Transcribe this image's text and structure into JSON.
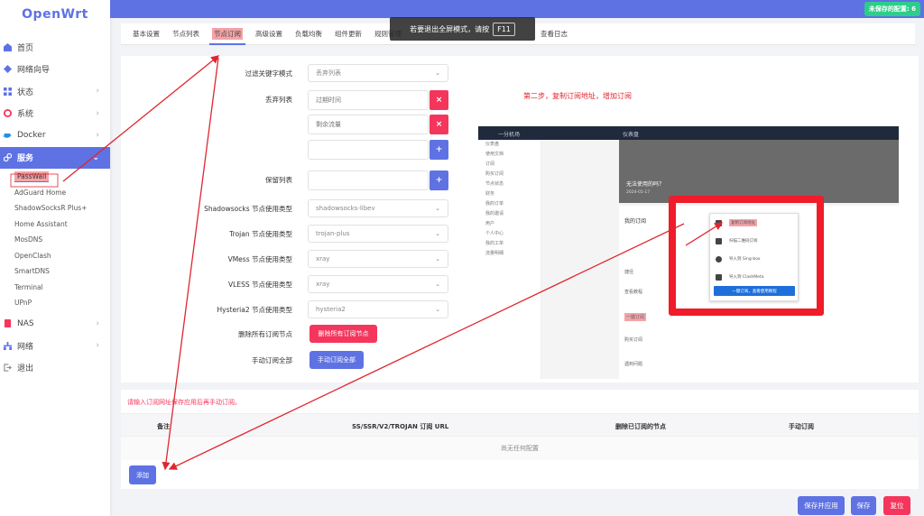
{
  "brand": {
    "logo": "OpenWrt"
  },
  "header": {
    "unsaved_label": "未保存的配置: 6"
  },
  "fullscreen": {
    "message": "若要退出全屏模式，请按",
    "key": "F11"
  },
  "sidebar": {
    "items": [
      {
        "label": "首页",
        "icon": "home-icon"
      },
      {
        "label": "网络向导",
        "icon": "wizard-icon"
      },
      {
        "label": "状态",
        "icon": "status-icon"
      },
      {
        "label": "系统",
        "icon": "gear-icon"
      },
      {
        "label": "Docker",
        "icon": "docker-icon"
      },
      {
        "label": "服务",
        "icon": "services-icon"
      }
    ],
    "sub_items": [
      "PassWall",
      "AdGuard Home",
      "ShadowSocksR Plus+",
      "Home Assistant",
      "MosDNS",
      "OpenClash",
      "SmartDNS",
      "Terminal",
      "UPnP"
    ],
    "bottom_items": [
      {
        "label": "NAS",
        "icon": "nas-icon"
      },
      {
        "label": "网络",
        "icon": "network-icon"
      },
      {
        "label": "退出",
        "icon": "logout-icon"
      }
    ]
  },
  "tabs": [
    "基本设置",
    "节点列表",
    "节点订阅",
    "高级设置",
    "负载均衡",
    "组件更新",
    "规则管理",
    "查看日志"
  ],
  "form": {
    "filter_mode_label": "过滤关键字模式",
    "filter_mode_value": "丢弃列表",
    "discard_list_label": "丢弃列表",
    "discard_items": [
      "过期时间",
      "剩余流量"
    ],
    "keep_list_label": "保留列表",
    "ss_label": "Shadowsocks 节点使用类型",
    "ss_value": "shadowsocks-libev",
    "trojan_label": "Trojan 节点使用类型",
    "trojan_value": "trojan-plus",
    "vmess_label": "VMess 节点使用类型",
    "vmess_value": "xray",
    "vless_label": "VLESS 节点使用类型",
    "vless_value": "xray",
    "hysteria2_label": "Hysteria2 节点使用类型",
    "hysteria2_value": "hysteria2",
    "delete_all_label": "删除所有订阅节点",
    "delete_all_button": "删除所有订阅节点",
    "manual_all_label": "手动订阅全部",
    "manual_all_button": "手动订阅全部"
  },
  "annotation": {
    "step2": "第二步，复制订阅地址，增加订阅"
  },
  "embed": {
    "top_left": "一分机场",
    "top_mid": "仪表盘",
    "hero_text": "无法使用的吗？",
    "hero_date": "2024-01-17",
    "section_label": "我的订阅",
    "side": [
      "仪表盘",
      "使用文档",
      "订阅",
      "购买订阅",
      "节点状态",
      "财务",
      "我的订单",
      "我的邀请",
      "用户",
      "个人中心",
      "我的工单",
      "流量明细"
    ],
    "list": [
      "捷径",
      "查看教程",
      "一键订阅",
      "购买订阅",
      "遇到问题"
    ],
    "popup_items": [
      "复制订阅地址",
      "扫描二维码订阅",
      "导入到 Sing-box",
      "导入到 ClashMeta"
    ],
    "popup_button": "一键订阅，查看使用教程"
  },
  "table": {
    "note": "请输入订阅网址保存应用后再手动订阅。",
    "headers": [
      "备注",
      "SS/SSR/V2/TROJAN 订阅 URL",
      "删除已订阅的节点",
      "手动订阅"
    ],
    "empty": "尚无任何配置",
    "add_button": "添加"
  },
  "footer": {
    "save_apply": "保存并应用",
    "save": "保存",
    "reset": "复位"
  },
  "colors": {
    "primary": "#5e72e4",
    "danger": "#f5365c",
    "success": "#2dce89",
    "annotation": "#e0262f"
  }
}
